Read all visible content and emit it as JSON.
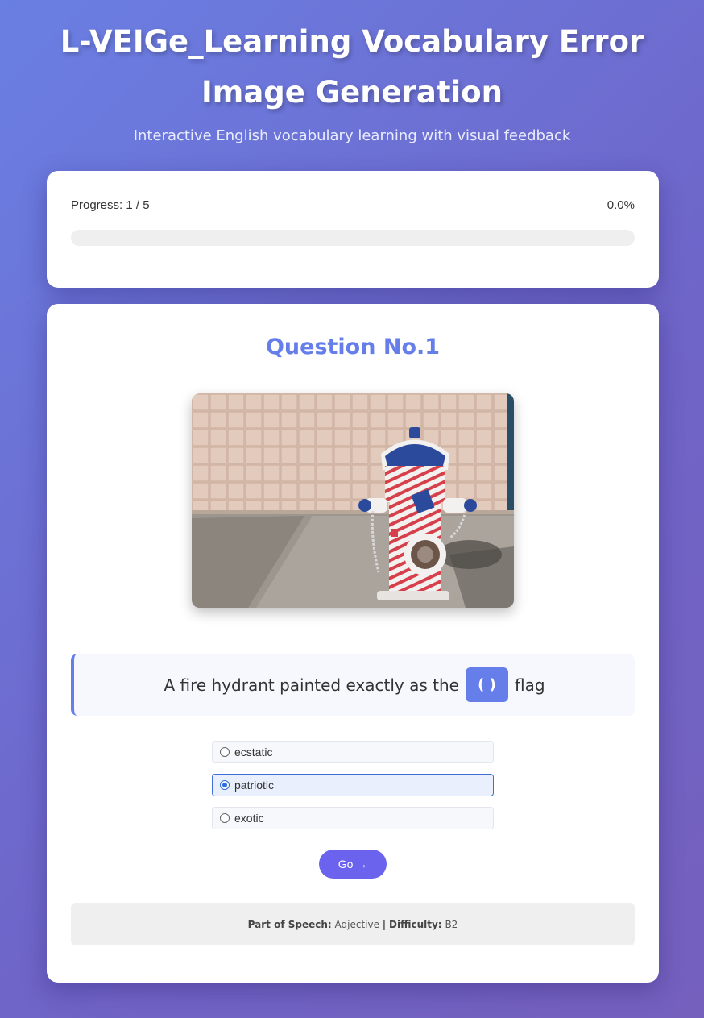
{
  "header": {
    "title": "L-VEIGe_Learning Vocabulary Error Image Generation",
    "subtitle": "Interactive English vocabulary learning with visual feedback"
  },
  "progress": {
    "label": "Progress: 1 / 5",
    "percent_text": "0.0%",
    "fraction": 0.0
  },
  "question": {
    "title": "Question No.1",
    "image_icon": "fire-hydrant-photo",
    "sentence_before": "A fire hydrant painted exactly as the",
    "blank": "( )",
    "sentence_after": "flag",
    "options": [
      {
        "label": "ecstatic",
        "selected": false
      },
      {
        "label": "patriotic",
        "selected": true
      },
      {
        "label": "exotic",
        "selected": false
      }
    ],
    "go_label": "Go →",
    "meta": {
      "pos_label": "Part of Speech:",
      "pos_value": "Adjective",
      "separator": "|",
      "difficulty_label": "Difficulty:",
      "difficulty_value": "B2"
    }
  },
  "colors": {
    "accent": "#667eea",
    "button": "#6b63ee",
    "selected_border": "#3f6fd6"
  }
}
